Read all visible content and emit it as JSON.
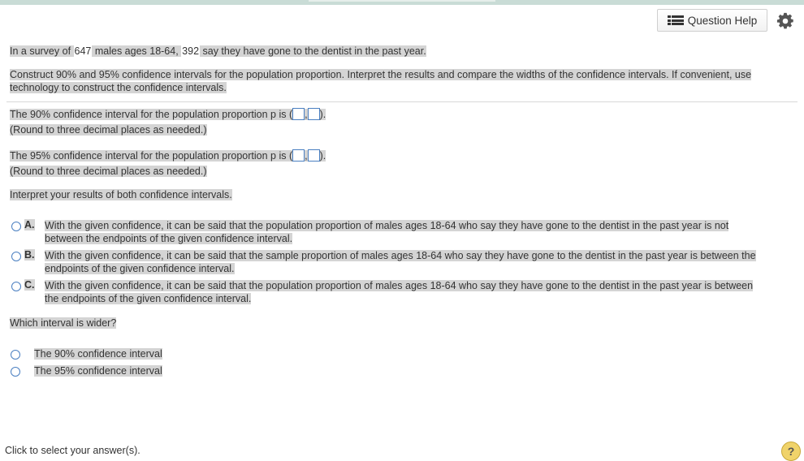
{
  "header": {
    "question_help": "Question Help"
  },
  "problem": {
    "intro_pre": "In a survey of ",
    "n": "647",
    "intro_mid": " males ages 18-64, ",
    "x": "392",
    "intro_post": " say they have gone to the dentist in the past year.",
    "task_line1": "Construct 90% and 95% confidence intervals for the population proportion. Interpret the results and compare the widths of the confidence intervals. If convenient, use",
    "task_line2": "technology to construct the confidence intervals."
  },
  "part1": {
    "prompt": "The 90% confidence interval for the population proportion p is (",
    "comma": ",",
    "close": ").",
    "note": "(Round to three decimal places as needed.)"
  },
  "part2": {
    "prompt": "The 95% confidence interval for the population proportion p is (",
    "comma": ",",
    "close": ").",
    "note": "(Round to three decimal places as needed.)"
  },
  "interpret": {
    "prompt": "Interpret your results of both confidence intervals.",
    "options": [
      {
        "letter": "A.",
        "line1": "With the given confidence, it can be said that the population proportion of males ages 18-64 who say they have gone to the dentist in the past year is not",
        "line2": "between the endpoints of the given confidence interval."
      },
      {
        "letter": "B.",
        "line1": "With the given confidence, it can be said that the sample proportion of males ages 18-64 who say they have gone to the dentist in the past year is between the",
        "line2": "endpoints of the given confidence interval."
      },
      {
        "letter": "C.",
        "line1": "With the given confidence, it can be said that the population proportion of males ages 18-64 who say they have gone to the dentist in the past year is between",
        "line2": "the endpoints of the given confidence interval."
      }
    ]
  },
  "wider": {
    "prompt": "Which interval is wider?",
    "options": [
      "The 90% confidence interval",
      "The 95% confidence interval"
    ]
  },
  "footer": {
    "instruction": "Click to select your answer(s).",
    "help": "?"
  }
}
